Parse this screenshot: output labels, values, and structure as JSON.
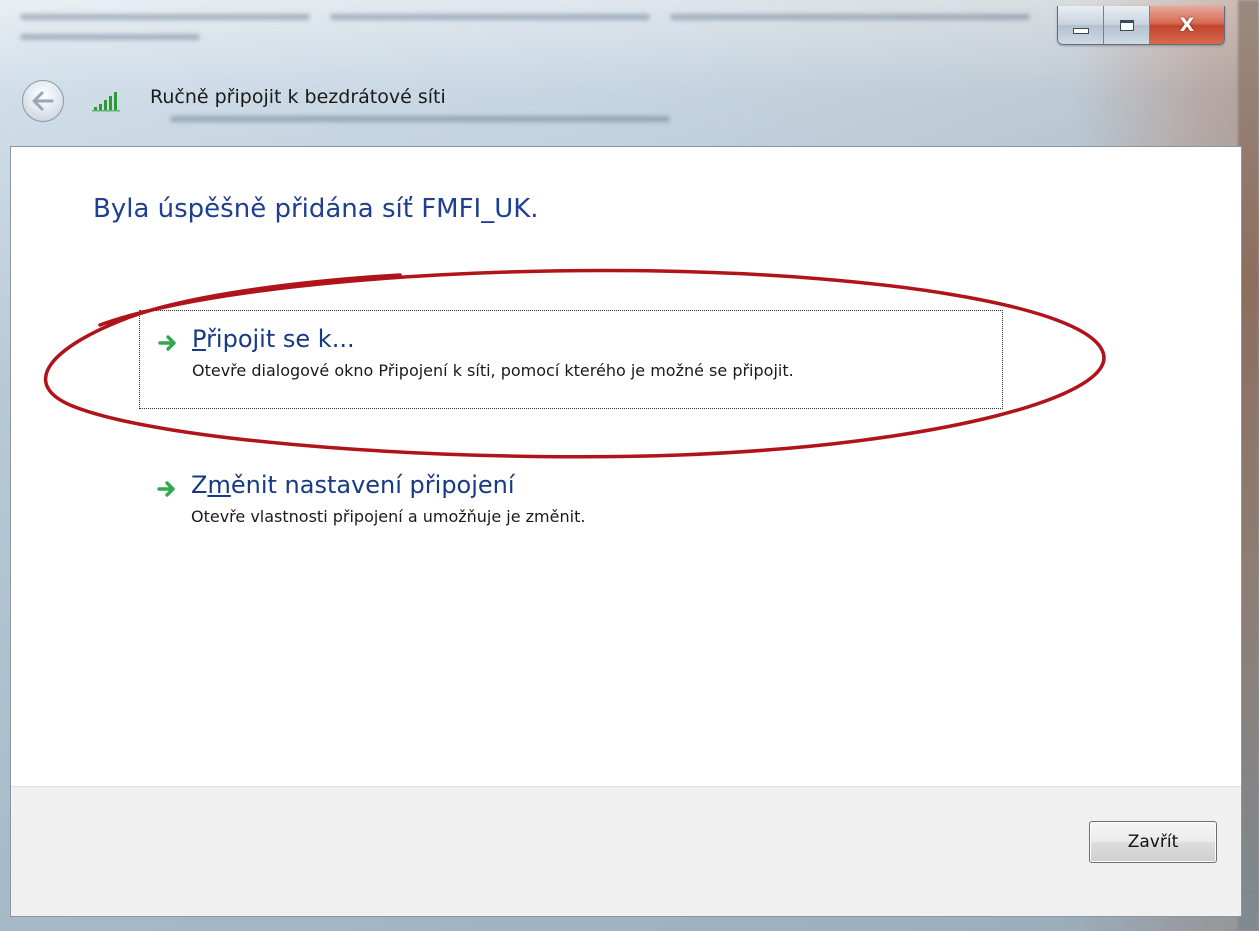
{
  "window": {
    "header_title": "Ručně připojit k bezdrátové síti",
    "caption": {
      "minimize_glyph": "",
      "maximize_glyph": "",
      "close_glyph": "X"
    }
  },
  "content": {
    "heading": "Byla úspěšně přidána síť FMFI_UK.",
    "commands": [
      {
        "title_accel": "P",
        "title_rest": "řipojit se k...",
        "description": "Otevře dialogové okno Připojení k síti, pomocí kterého je možné se připojit."
      },
      {
        "title_pre": "Z",
        "title_accel": "m",
        "title_rest": "ěnit nastavení připojení",
        "description": "Otevře vlastnosti připojení a umožňuje je změnit."
      }
    ]
  },
  "footer": {
    "close_label": "Zavřít"
  },
  "colors": {
    "heading": "#1e3f92",
    "link": "#163a86",
    "arrow": "#2fa84f",
    "annotation": "#b0141a",
    "close_caption": "#c1452c"
  },
  "icons": {
    "back": "back-arrow-icon",
    "signal": "wireless-signal-icon",
    "command_arrow": "green-arrow-icon"
  }
}
